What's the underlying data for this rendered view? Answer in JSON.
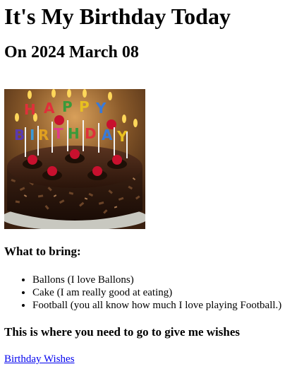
{
  "heading": "It's My Birthday Today",
  "subheading": "On 2024 March 08",
  "image": {
    "description_icon": "birthday-cake-image",
    "banner_text": "HAPPY BIRTHDAY"
  },
  "bring": {
    "title": "What to bring:",
    "items": [
      "Ballons (I love Ballons)",
      "Cake (I am really good at eating)",
      "Football (you all know how much I love playing Football.)"
    ]
  },
  "wishes": {
    "title": "This is where you need to go to give me wishes",
    "link_text": "Birthday Wishes"
  },
  "colors": {
    "link": "#0000ee",
    "text": "#000000"
  }
}
